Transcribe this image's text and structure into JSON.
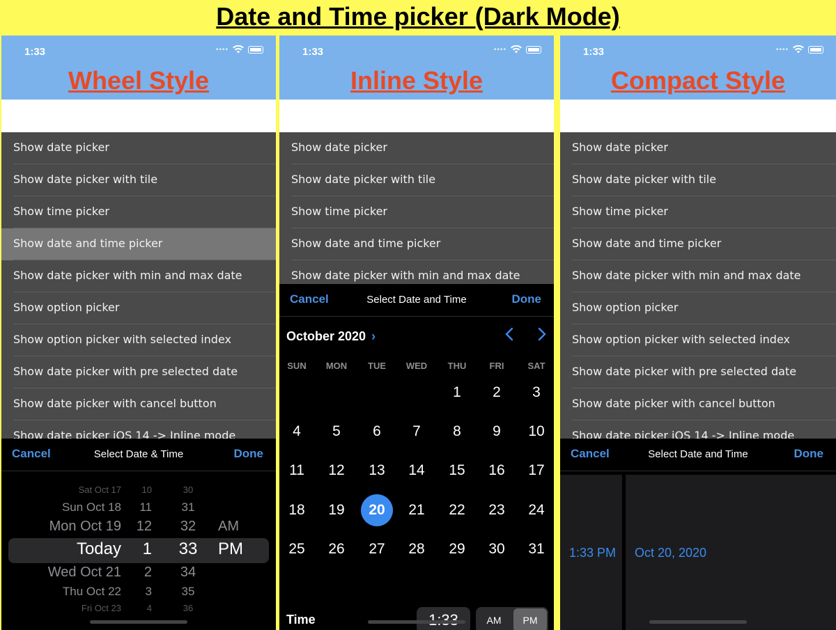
{
  "page_title": "Date and Time picker (Dark Mode)",
  "status_time": "1:33",
  "list_items": [
    "Show date picker",
    "Show date picker with tile",
    "Show time picker",
    "Show date and time picker",
    "Show date picker with min and max date",
    "Show option picker",
    "Show option picker with selected index",
    "Show date picker with pre selected date",
    "Show date picker with cancel button",
    "Show date picker iOS 14 -> Inline mode"
  ],
  "wheel_panel": {
    "style_title": "Wheel Style",
    "toolbar": {
      "cancel": "Cancel",
      "title": "Select Date & Time",
      "done": "Done"
    },
    "rows": [
      {
        "date": "Sat Oct 17",
        "hour": "10",
        "minute": "30",
        "ampm": ""
      },
      {
        "date": "Sun Oct 18",
        "hour": "11",
        "minute": "31",
        "ampm": ""
      },
      {
        "date": "Mon Oct 19",
        "hour": "12",
        "minute": "32",
        "ampm": "AM"
      },
      {
        "date": "Today",
        "hour": "1",
        "minute": "33",
        "ampm": "PM"
      },
      {
        "date": "Wed Oct 21",
        "hour": "2",
        "minute": "34",
        "ampm": ""
      },
      {
        "date": "Thu Oct 22",
        "hour": "3",
        "minute": "35",
        "ampm": ""
      },
      {
        "date": "Fri Oct 23",
        "hour": "4",
        "minute": "36",
        "ampm": ""
      }
    ]
  },
  "inline_panel": {
    "style_title": "Inline Style",
    "toolbar": {
      "cancel": "Cancel",
      "title": "Select Date and Time",
      "done": "Done"
    },
    "month": "October 2020",
    "weekdays": [
      "SUN",
      "MON",
      "TUE",
      "WED",
      "THU",
      "FRI",
      "SAT"
    ],
    "first_weekday_index": 4,
    "days_in_month": 31,
    "selected_day": "20",
    "time_label": "Time",
    "time_value": "1:33",
    "am": "AM",
    "pm": "PM"
  },
  "compact_panel": {
    "style_title": "Compact Style",
    "toolbar": {
      "cancel": "Cancel",
      "title": "Select Date and Time",
      "done": "Done"
    },
    "time_value": "1:33 PM",
    "date_value": "Oct 20, 2020"
  },
  "colors": {
    "background": "#fefa5a",
    "header": "#7bb2ec",
    "style_title": "#e84a26",
    "accent": "#3a8bf0",
    "list_bg": "#4a4a4a"
  }
}
